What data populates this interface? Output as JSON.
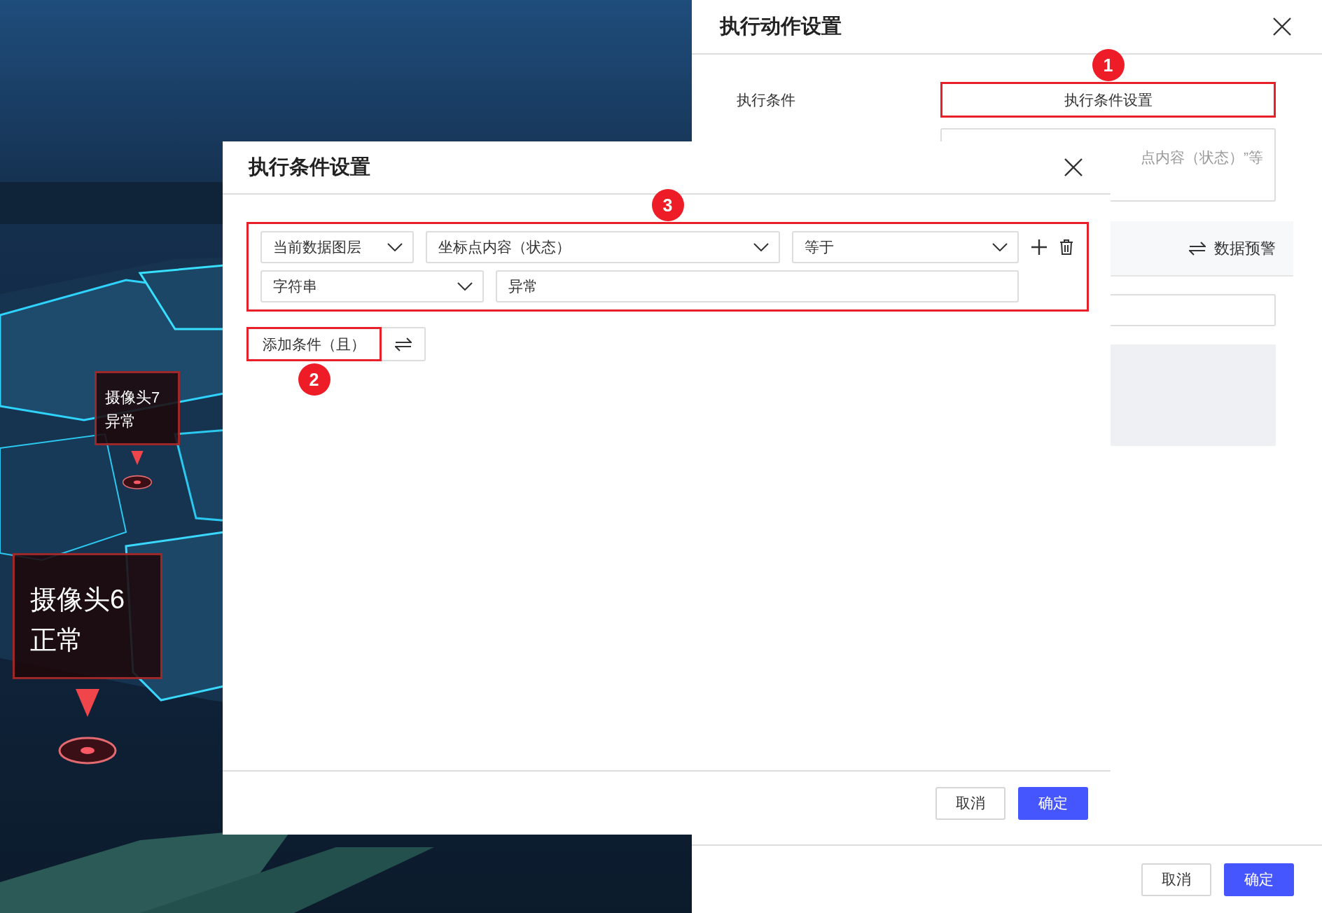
{
  "scene": {
    "kind": "picture",
    "markers": [
      {
        "name": "摄像头7",
        "status": "异常",
        "kind": "small"
      },
      {
        "name": "摄像头6",
        "status": "正常",
        "kind": "large"
      }
    ]
  },
  "action_panel": {
    "title": "执行动作设置",
    "condition_label": "执行条件",
    "condition_button": {
      "label": "执行条件设置",
      "highlighted": true,
      "badge": "1"
    },
    "condition_summary": "点内容（状态）”等",
    "mode_switch": {
      "label": "数据预警"
    },
    "buttons": [
      {
        "label": "取消",
        "kind": "secondary"
      },
      {
        "label": "确定",
        "kind": "primary"
      }
    ]
  },
  "dialog": {
    "title": "执行条件设置",
    "condition_group": {
      "highlighted": true,
      "badge": "3",
      "conditions": [
        {
          "source": "当前数据图层",
          "field": "坐标点内容（状态）",
          "operator": "等于",
          "value_type": "字符串",
          "value": "异常"
        }
      ]
    },
    "add_button": {
      "label": "添加条件（且）",
      "highlighted": true,
      "badge": "2"
    },
    "buttons": [
      {
        "label": "取消",
        "kind": "secondary"
      },
      {
        "label": "确定",
        "kind": "primary"
      }
    ]
  }
}
